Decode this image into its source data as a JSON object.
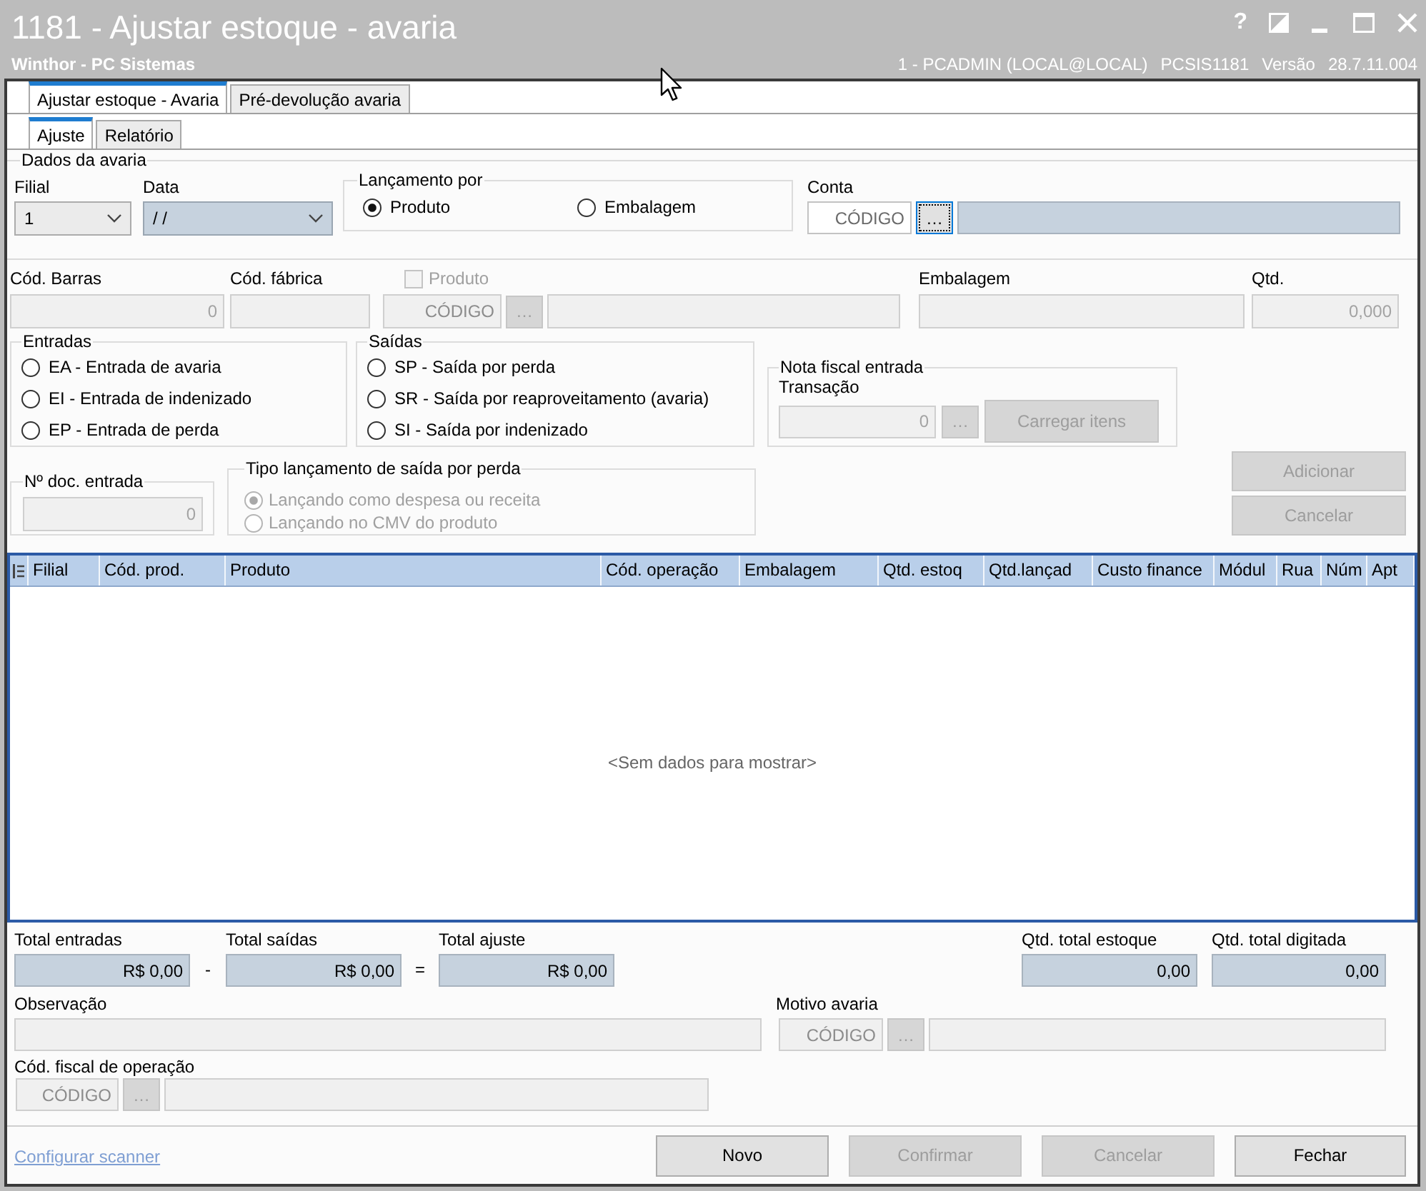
{
  "window": {
    "title": "1181 - Ajustar estoque - avaria",
    "help": "?",
    "subtitle": "Winthor - PC Sistemas",
    "user": "1 - PCADMIN (LOCAL@LOCAL)",
    "program": "PCSIS1181",
    "version_label": "Versão",
    "version": "28.7.11.004"
  },
  "tabs": [
    {
      "label": "Ajustar estoque - Avaria",
      "selected": true
    },
    {
      "label": "Pré-devolução avaria",
      "selected": false
    }
  ],
  "subtabs": [
    {
      "label": "Ajuste",
      "selected": true
    },
    {
      "label": "Relatório",
      "selected": false
    }
  ],
  "dados": {
    "title": "Dados da avaria",
    "filial": {
      "label": "Filial",
      "value": "1",
      "disabled": false,
      "highlighted": false
    },
    "data": {
      "label": "Data",
      "value": "/ /",
      "disabled": false,
      "highlighted": true
    },
    "lancamento": {
      "title": "Lançamento por",
      "options": [
        {
          "label": "Produto",
          "selected": true
        },
        {
          "label": "Embalagem",
          "selected": false
        }
      ]
    },
    "conta": {
      "label": "Conta",
      "code": {
        "placeholder": "CÓDIGO",
        "disabled": false,
        "highlighted": false
      },
      "button": {
        "label": "…",
        "disabled": false,
        "focused": true
      },
      "description": {
        "disabled": false,
        "highlighted": true
      }
    }
  },
  "item": {
    "cod_barras": {
      "label": "Cód. Barras",
      "value": "0",
      "disabled": true
    },
    "cod_fabrica": {
      "label": "Cód. fábrica",
      "disabled": true
    },
    "produto": {
      "label": "Produto",
      "checked": false,
      "disabled": true,
      "code": {
        "placeholder": "CÓDIGO",
        "disabled": true
      },
      "button": {
        "label": "…",
        "disabled": true
      },
      "description": {
        "disabled": true
      }
    },
    "embalagem": {
      "label": "Embalagem",
      "disabled": true
    },
    "qtd": {
      "label": "Qtd.",
      "value": "0,000",
      "disabled": true
    }
  },
  "entradas": {
    "title": "Entradas",
    "options": [
      {
        "label": "EA - Entrada de avaria",
        "selected": false
      },
      {
        "label": "EI - Entrada de indenizado",
        "selected": false
      },
      {
        "label": "EP - Entrada de perda",
        "selected": false
      }
    ]
  },
  "saidas": {
    "title": "Saídas",
    "options": [
      {
        "label": "SP - Saída por perda",
        "selected": false
      },
      {
        "label": "SR - Saída por reaproveitamento (avaria)",
        "selected": false
      },
      {
        "label": "SI - Saída por indenizado",
        "selected": false
      }
    ]
  },
  "nota_fiscal": {
    "title": "Nota fiscal entrada",
    "transacao": {
      "label": "Transação",
      "value": "0",
      "disabled": true
    },
    "button": {
      "label": "…",
      "disabled": true
    },
    "load_button": {
      "label": "Carregar itens",
      "disabled": true
    }
  },
  "doc_entrada": {
    "title": "Nº doc. entrada",
    "field": {
      "value": "0",
      "disabled": true
    }
  },
  "tipo_lancamento": {
    "title": "Tipo lançamento de saída por perda",
    "options": [
      {
        "label": "Lançando como despesa ou receita",
        "selected": true,
        "disabled": true
      },
      {
        "label": "Lançando no CMV do produto",
        "selected": false,
        "disabled": true
      }
    ]
  },
  "actions": [
    {
      "label": "Adicionar",
      "disabled": true
    },
    {
      "label": "Cancelar",
      "disabled": true
    }
  ],
  "table": {
    "columns": [
      "Filial",
      "Cód. prod.",
      "Produto",
      "Cód. operação",
      "Embalagem",
      "Qtd. estoq",
      "Qtd.lançad",
      "Custo finance",
      "Módul",
      "Rua",
      "Núm",
      "Apt"
    ],
    "empty_text": "<Sem dados para mostrar>"
  },
  "totals": {
    "entradas": {
      "label": "Total entradas",
      "value": "R$ 0,00",
      "disabled": false,
      "highlighted": true
    },
    "minus": "-",
    "saidas": {
      "label": "Total saídas",
      "value": "R$ 0,00",
      "disabled": false,
      "highlighted": true
    },
    "equals": "=",
    "ajuste": {
      "label": "Total ajuste",
      "value": "R$ 0,00",
      "disabled": false,
      "highlighted": true
    },
    "qtd_estoque": {
      "label": "Qtd. total estoque",
      "value": "0,00",
      "disabled": false,
      "highlighted": true
    },
    "qtd_digitada": {
      "label": "Qtd. total digitada",
      "value": "0,00",
      "disabled": false,
      "highlighted": true
    }
  },
  "observacao": {
    "label": "Observação",
    "disabled": true
  },
  "motivo": {
    "label": "Motivo avaria",
    "code": {
      "placeholder": "CÓDIGO",
      "disabled": true
    },
    "button": {
      "label": "…",
      "disabled": true
    },
    "description": {
      "disabled": true
    }
  },
  "cfop": {
    "label": "Cód. fiscal de operação",
    "code": {
      "placeholder": "CÓDIGO",
      "disabled": true
    },
    "button": {
      "label": "…",
      "disabled": true
    },
    "description": {
      "disabled": true
    }
  },
  "footer": {
    "link": "Configurar scanner",
    "buttons": [
      {
        "label": "Novo",
        "disabled": false
      },
      {
        "label": "Confirmar",
        "disabled": true
      },
      {
        "label": "Cancelar",
        "disabled": true
      },
      {
        "label": "Fechar",
        "disabled": false
      }
    ]
  }
}
